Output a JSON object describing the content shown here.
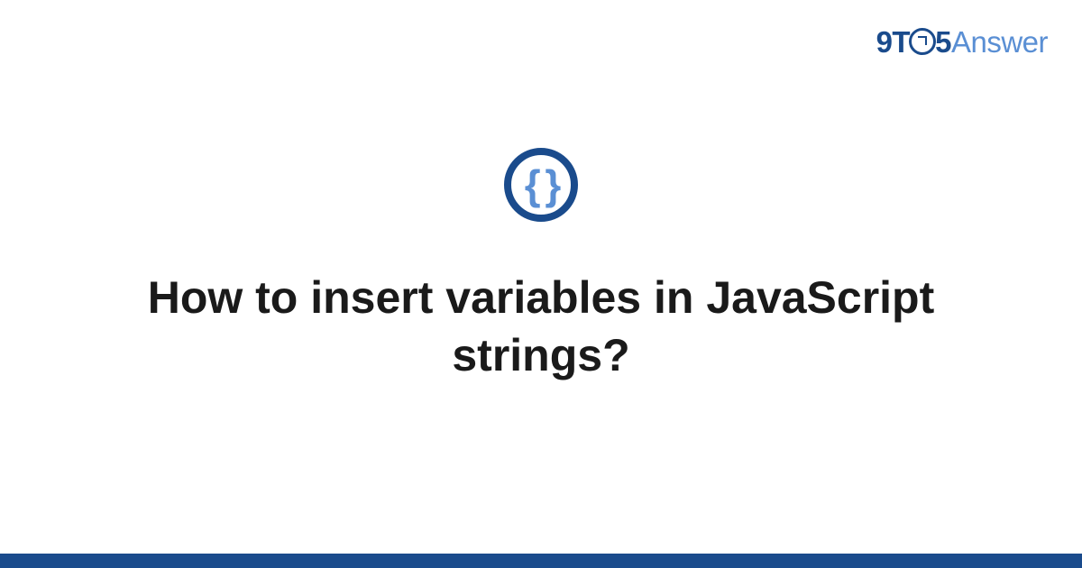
{
  "logo": {
    "part1": "9T",
    "part2": "5",
    "part3": "Answer"
  },
  "icon": {
    "braces": "{ }"
  },
  "title": "How to insert variables in JavaScript strings?",
  "colors": {
    "primary": "#1a4b8c",
    "accent": "#5a8fd4"
  }
}
